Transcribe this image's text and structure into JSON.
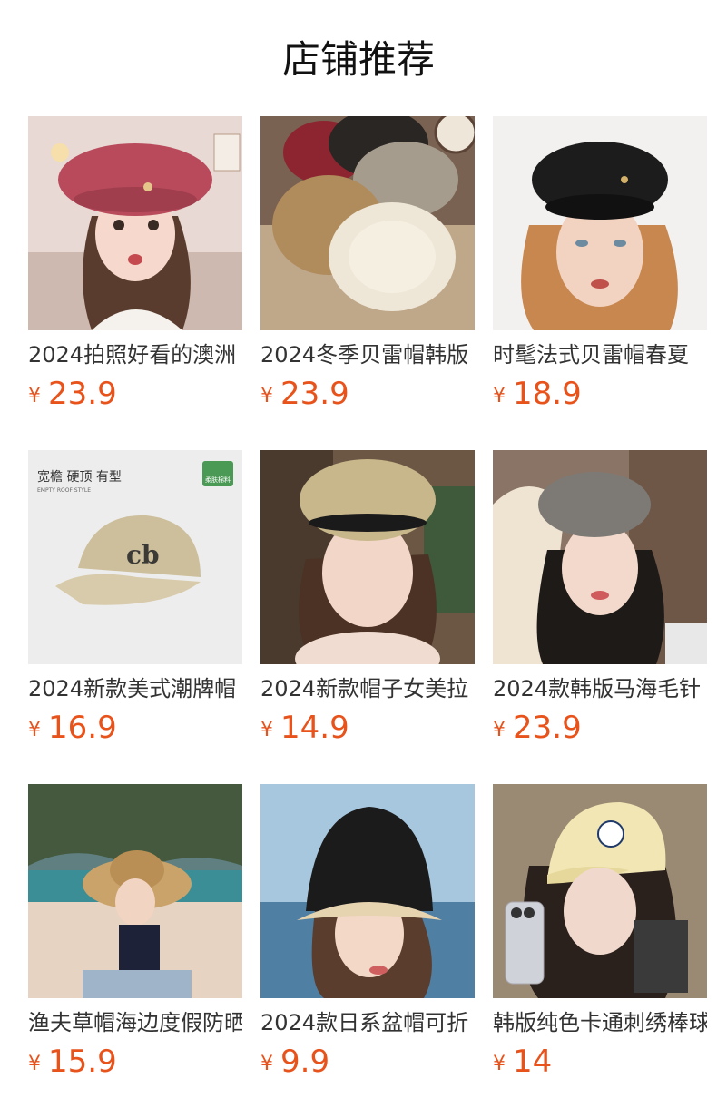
{
  "header": {
    "title": "店铺推荐"
  },
  "currency": "¥",
  "products": [
    {
      "name": "2024拍照好看的澳洲",
      "price": "23.9",
      "image": "woman-red-beret"
    },
    {
      "name": "2024冬季贝雷帽韩版",
      "price": "23.9",
      "image": "fuzzy-berets"
    },
    {
      "name": "时髦法式贝雷帽春夏",
      "price": "18.9",
      "image": "woman-black-beret"
    },
    {
      "name": "2024新款美式潮牌帽",
      "price": "16.9",
      "image": "beige-baseball-cap",
      "image_text": {
        "tagline": "宽檐 硬顶 有型",
        "sub": "EMPTY ROOF STYLE",
        "badge": "柔肤棉料"
      }
    },
    {
      "name": "2024新款帽子女美拉",
      "price": "14.9",
      "image": "woman-knit-beret"
    },
    {
      "name": "2024款韩版马海毛针",
      "price": "23.9",
      "image": "woman-grey-beret"
    },
    {
      "name": "渔夫草帽海边度假防晒",
      "price": "15.9",
      "image": "woman-straw-hat"
    },
    {
      "name": "2024款日系盆帽可折",
      "price": "9.9",
      "image": "woman-black-bucket-hat"
    },
    {
      "name": "韩版纯色卡通刺绣棒球帽",
      "price": "14",
      "image": "woman-yellow-cap"
    }
  ]
}
